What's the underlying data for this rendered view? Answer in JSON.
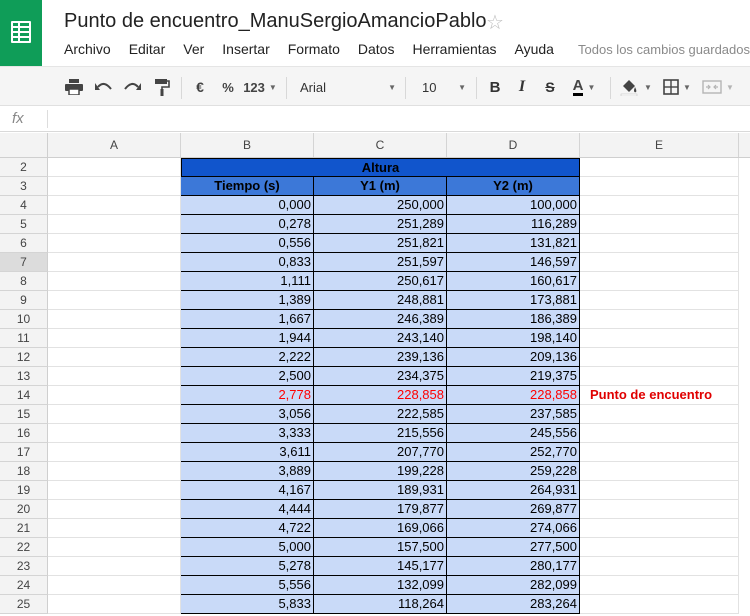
{
  "app": {
    "doc_title": "Punto de encuentro_ManuSergioAmancioPablo",
    "save_status": "Todos los cambios guardados"
  },
  "menu": [
    "Archivo",
    "Editar",
    "Ver",
    "Insertar",
    "Formato",
    "Datos",
    "Herramientas",
    "Ayuda"
  ],
  "toolbar": {
    "currency_label": "€",
    "percent_label": "%",
    "number_format_label": "123",
    "font_name": "Arial",
    "font_size": "10",
    "bold_label": "B",
    "italic_label": "I",
    "strike_label": "S",
    "text_color_label": "A"
  },
  "formula_bar": {
    "fx_label": "fx",
    "value": ""
  },
  "columns": [
    "A",
    "B",
    "C",
    "D",
    "E"
  ],
  "sheet": {
    "group_header": "Altura",
    "headers": [
      "Tiempo (s)",
      "Y1 (m)",
      "Y2 (m)"
    ],
    "note": "Punto de encuentro",
    "rows": [
      {
        "n": "2"
      },
      {
        "n": "3"
      },
      {
        "n": "4",
        "b": "0,000",
        "c": "250,000",
        "d": "100,000"
      },
      {
        "n": "5",
        "b": "0,278",
        "c": "251,289",
        "d": "116,289"
      },
      {
        "n": "6",
        "b": "0,556",
        "c": "251,821",
        "d": "131,821"
      },
      {
        "n": "7",
        "b": "0,833",
        "c": "251,597",
        "d": "146,597"
      },
      {
        "n": "8",
        "b": "1,111",
        "c": "250,617",
        "d": "160,617"
      },
      {
        "n": "9",
        "b": "1,389",
        "c": "248,881",
        "d": "173,881"
      },
      {
        "n": "10",
        "b": "1,667",
        "c": "246,389",
        "d": "186,389"
      },
      {
        "n": "11",
        "b": "1,944",
        "c": "243,140",
        "d": "198,140"
      },
      {
        "n": "12",
        "b": "2,222",
        "c": "239,136",
        "d": "209,136"
      },
      {
        "n": "13",
        "b": "2,500",
        "c": "234,375",
        "d": "219,375"
      },
      {
        "n": "14",
        "b": "2,778",
        "c": "228,858",
        "d": "228,858"
      },
      {
        "n": "15",
        "b": "3,056",
        "c": "222,585",
        "d": "237,585"
      },
      {
        "n": "16",
        "b": "3,333",
        "c": "215,556",
        "d": "245,556"
      },
      {
        "n": "17",
        "b": "3,611",
        "c": "207,770",
        "d": "252,770"
      },
      {
        "n": "18",
        "b": "3,889",
        "c": "199,228",
        "d": "259,228"
      },
      {
        "n": "19",
        "b": "4,167",
        "c": "189,931",
        "d": "264,931"
      },
      {
        "n": "20",
        "b": "4,444",
        "c": "179,877",
        "d": "269,877"
      },
      {
        "n": "21",
        "b": "4,722",
        "c": "169,066",
        "d": "274,066"
      },
      {
        "n": "22",
        "b": "5,000",
        "c": "157,500",
        "d": "277,500"
      },
      {
        "n": "23",
        "b": "5,278",
        "c": "145,177",
        "d": "280,177"
      },
      {
        "n": "24",
        "b": "5,556",
        "c": "132,099",
        "d": "282,099"
      },
      {
        "n": "25",
        "b": "5,833",
        "c": "118,264",
        "d": "283,264"
      }
    ]
  },
  "colors": {
    "logo_green": "#0f9d58",
    "band_header": "#1155cc",
    "column_header": "#3c78d8",
    "data_fill": "#c9daf8",
    "highlight_red": "#ff0000"
  }
}
